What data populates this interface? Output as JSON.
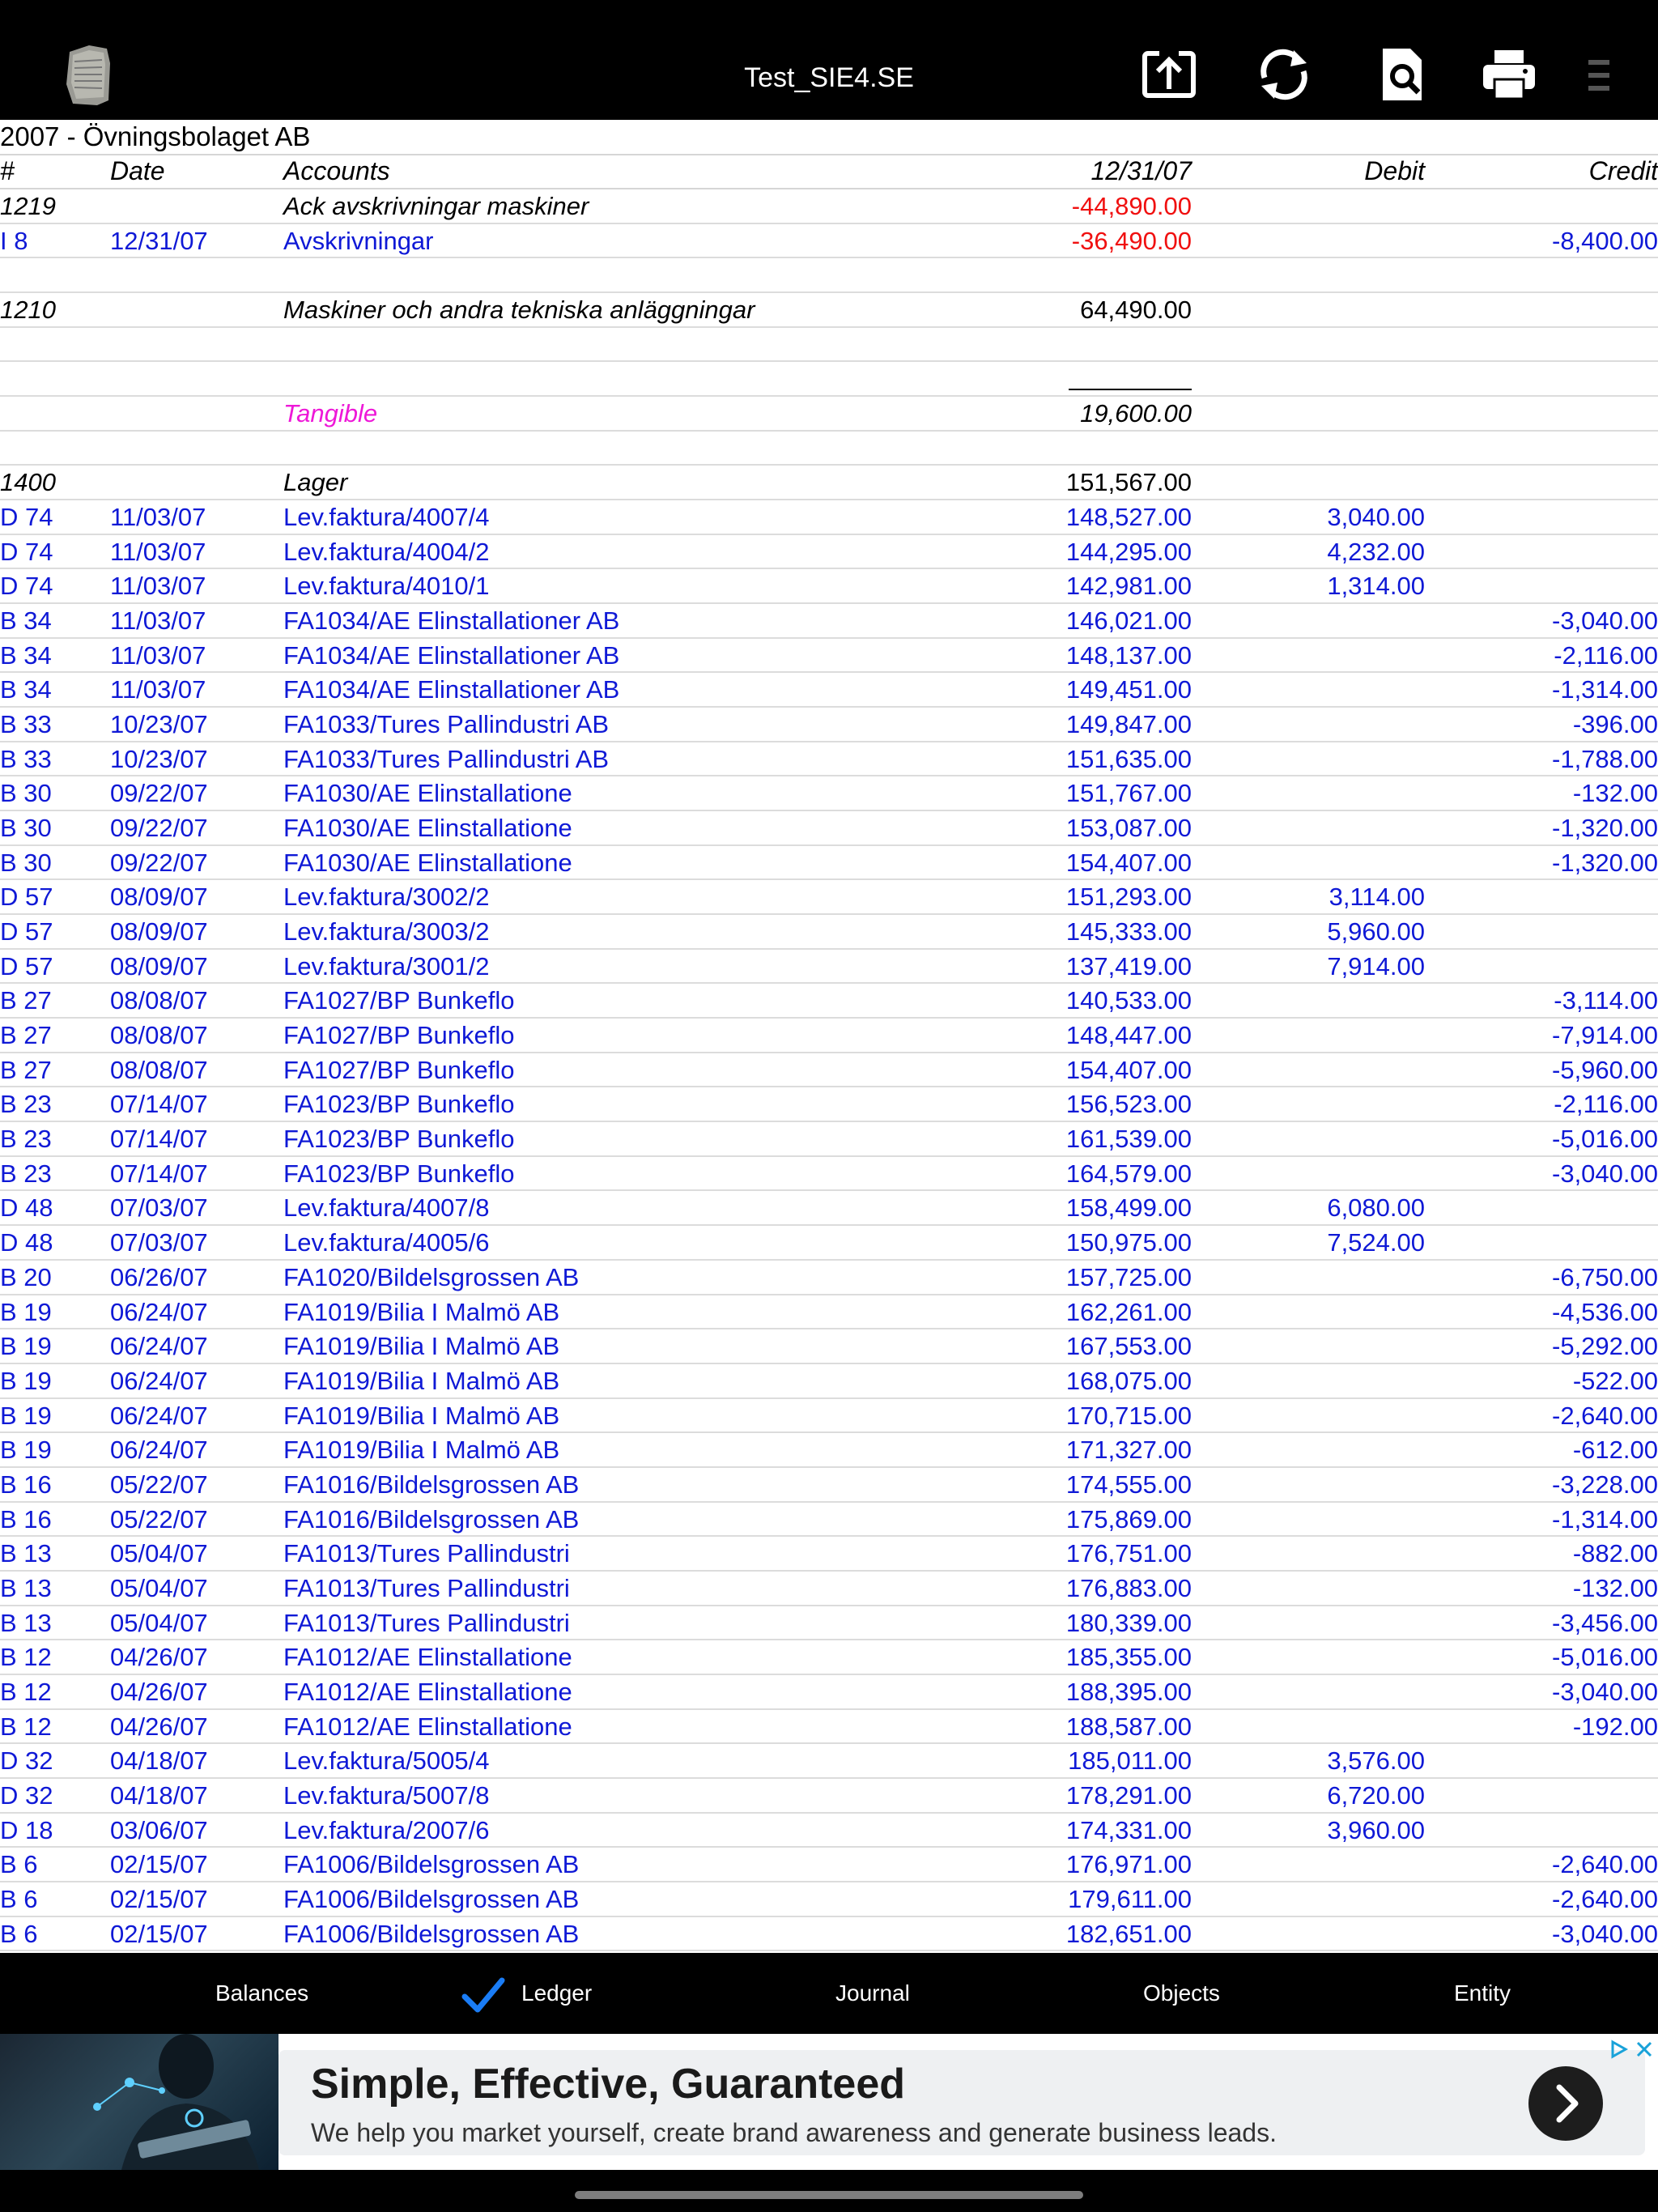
{
  "window": {
    "title": "Test_SIE4.SE",
    "icons": [
      "app-logo-icon",
      "export-icon",
      "sync-icon",
      "search-document-icon",
      "print-icon",
      "more-icon"
    ]
  },
  "ledger": {
    "company": "2007 - Övningsbolaget AB",
    "columns": {
      "num": "#",
      "date": "Date",
      "accounts": "Accounts",
      "balance": "12/31/07",
      "debit": "Debit",
      "credit": "Credit"
    },
    "rows": [
      {
        "type": "header",
        "num": "1219",
        "date": "",
        "account": "Ack avskrivningar maskiner",
        "balance": "-44,890.00",
        "debit": "",
        "credit": ""
      },
      {
        "type": "entry",
        "num": "I 8",
        "date": "12/31/07",
        "account": "Avskrivningar",
        "balance": "-36,490.00",
        "debit": "",
        "credit": "-8,400.00"
      },
      {
        "type": "blank"
      },
      {
        "type": "header",
        "num": "1210",
        "date": "",
        "account": "Maskiner och andra tekniska anläggningar",
        "balance": "64,490.00",
        "debit": "",
        "credit": ""
      },
      {
        "type": "blank"
      },
      {
        "type": "rule"
      },
      {
        "type": "subtotal",
        "account": "Tangible",
        "balance": "19,600.00"
      },
      {
        "type": "blank"
      },
      {
        "type": "header",
        "num": "1400",
        "date": "",
        "account": "Lager",
        "balance": "151,567.00",
        "debit": "",
        "credit": ""
      },
      {
        "type": "entry",
        "num": "D 74",
        "date": "11/03/07",
        "account": "Lev.faktura/4007/4",
        "balance": "148,527.00",
        "debit": "3,040.00",
        "credit": ""
      },
      {
        "type": "entry",
        "num": "D 74",
        "date": "11/03/07",
        "account": "Lev.faktura/4004/2",
        "balance": "144,295.00",
        "debit": "4,232.00",
        "credit": ""
      },
      {
        "type": "entry",
        "num": "D 74",
        "date": "11/03/07",
        "account": "Lev.faktura/4010/1",
        "balance": "142,981.00",
        "debit": "1,314.00",
        "credit": ""
      },
      {
        "type": "entry",
        "num": "B 34",
        "date": "11/03/07",
        "account": "FA1034/AE Elinstallationer AB",
        "balance": "146,021.00",
        "debit": "",
        "credit": "-3,040.00"
      },
      {
        "type": "entry",
        "num": "B 34",
        "date": "11/03/07",
        "account": "FA1034/AE Elinstallationer AB",
        "balance": "148,137.00",
        "debit": "",
        "credit": "-2,116.00"
      },
      {
        "type": "entry",
        "num": "B 34",
        "date": "11/03/07",
        "account": "FA1034/AE Elinstallationer AB",
        "balance": "149,451.00",
        "debit": "",
        "credit": "-1,314.00"
      },
      {
        "type": "entry",
        "num": "B 33",
        "date": "10/23/07",
        "account": "FA1033/Tures Pallindustri AB",
        "balance": "149,847.00",
        "debit": "",
        "credit": "-396.00"
      },
      {
        "type": "entry",
        "num": "B 33",
        "date": "10/23/07",
        "account": "FA1033/Tures Pallindustri AB",
        "balance": "151,635.00",
        "debit": "",
        "credit": "-1,788.00"
      },
      {
        "type": "entry",
        "num": "B 30",
        "date": "09/22/07",
        "account": "FA1030/AE Elinstallatione",
        "balance": "151,767.00",
        "debit": "",
        "credit": "-132.00"
      },
      {
        "type": "entry",
        "num": "B 30",
        "date": "09/22/07",
        "account": "FA1030/AE Elinstallatione",
        "balance": "153,087.00",
        "debit": "",
        "credit": "-1,320.00"
      },
      {
        "type": "entry",
        "num": "B 30",
        "date": "09/22/07",
        "account": "FA1030/AE Elinstallatione",
        "balance": "154,407.00",
        "debit": "",
        "credit": "-1,320.00"
      },
      {
        "type": "entry",
        "num": "D 57",
        "date": "08/09/07",
        "account": "Lev.faktura/3002/2",
        "balance": "151,293.00",
        "debit": "3,114.00",
        "credit": ""
      },
      {
        "type": "entry",
        "num": "D 57",
        "date": "08/09/07",
        "account": "Lev.faktura/3003/2",
        "balance": "145,333.00",
        "debit": "5,960.00",
        "credit": ""
      },
      {
        "type": "entry",
        "num": "D 57",
        "date": "08/09/07",
        "account": "Lev.faktura/3001/2",
        "balance": "137,419.00",
        "debit": "7,914.00",
        "credit": ""
      },
      {
        "type": "entry",
        "num": "B 27",
        "date": "08/08/07",
        "account": "FA1027/BP Bunkeflo",
        "balance": "140,533.00",
        "debit": "",
        "credit": "-3,114.00"
      },
      {
        "type": "entry",
        "num": "B 27",
        "date": "08/08/07",
        "account": "FA1027/BP Bunkeflo",
        "balance": "148,447.00",
        "debit": "",
        "credit": "-7,914.00"
      },
      {
        "type": "entry",
        "num": "B 27",
        "date": "08/08/07",
        "account": "FA1027/BP Bunkeflo",
        "balance": "154,407.00",
        "debit": "",
        "credit": "-5,960.00"
      },
      {
        "type": "entry",
        "num": "B 23",
        "date": "07/14/07",
        "account": "FA1023/BP Bunkeflo",
        "balance": "156,523.00",
        "debit": "",
        "credit": "-2,116.00"
      },
      {
        "type": "entry",
        "num": "B 23",
        "date": "07/14/07",
        "account": "FA1023/BP Bunkeflo",
        "balance": "161,539.00",
        "debit": "",
        "credit": "-5,016.00"
      },
      {
        "type": "entry",
        "num": "B 23",
        "date": "07/14/07",
        "account": "FA1023/BP Bunkeflo",
        "balance": "164,579.00",
        "debit": "",
        "credit": "-3,040.00"
      },
      {
        "type": "entry",
        "num": "D 48",
        "date": "07/03/07",
        "account": "Lev.faktura/4007/8",
        "balance": "158,499.00",
        "debit": "6,080.00",
        "credit": ""
      },
      {
        "type": "entry",
        "num": "D 48",
        "date": "07/03/07",
        "account": "Lev.faktura/4005/6",
        "balance": "150,975.00",
        "debit": "7,524.00",
        "credit": ""
      },
      {
        "type": "entry",
        "num": "B 20",
        "date": "06/26/07",
        "account": "FA1020/Bildelsgrossen AB",
        "balance": "157,725.00",
        "debit": "",
        "credit": "-6,750.00"
      },
      {
        "type": "entry",
        "num": "B 19",
        "date": "06/24/07",
        "account": "FA1019/Bilia I Malmö AB",
        "balance": "162,261.00",
        "debit": "",
        "credit": "-4,536.00"
      },
      {
        "type": "entry",
        "num": "B 19",
        "date": "06/24/07",
        "account": "FA1019/Bilia I Malmö AB",
        "balance": "167,553.00",
        "debit": "",
        "credit": "-5,292.00"
      },
      {
        "type": "entry",
        "num": "B 19",
        "date": "06/24/07",
        "account": "FA1019/Bilia I Malmö AB",
        "balance": "168,075.00",
        "debit": "",
        "credit": "-522.00"
      },
      {
        "type": "entry",
        "num": "B 19",
        "date": "06/24/07",
        "account": "FA1019/Bilia I Malmö AB",
        "balance": "170,715.00",
        "debit": "",
        "credit": "-2,640.00"
      },
      {
        "type": "entry",
        "num": "B 19",
        "date": "06/24/07",
        "account": "FA1019/Bilia I Malmö AB",
        "balance": "171,327.00",
        "debit": "",
        "credit": "-612.00"
      },
      {
        "type": "entry",
        "num": "B 16",
        "date": "05/22/07",
        "account": "FA1016/Bildelsgrossen AB",
        "balance": "174,555.00",
        "debit": "",
        "credit": "-3,228.00"
      },
      {
        "type": "entry",
        "num": "B 16",
        "date": "05/22/07",
        "account": "FA1016/Bildelsgrossen AB",
        "balance": "175,869.00",
        "debit": "",
        "credit": "-1,314.00"
      },
      {
        "type": "entry",
        "num": "B 13",
        "date": "05/04/07",
        "account": "FA1013/Tures Pallindustri",
        "balance": "176,751.00",
        "debit": "",
        "credit": "-882.00"
      },
      {
        "type": "entry",
        "num": "B 13",
        "date": "05/04/07",
        "account": "FA1013/Tures Pallindustri",
        "balance": "176,883.00",
        "debit": "",
        "credit": "-132.00"
      },
      {
        "type": "entry",
        "num": "B 13",
        "date": "05/04/07",
        "account": "FA1013/Tures Pallindustri",
        "balance": "180,339.00",
        "debit": "",
        "credit": "-3,456.00"
      },
      {
        "type": "entry",
        "num": "B 12",
        "date": "04/26/07",
        "account": "FA1012/AE Elinstallatione",
        "balance": "185,355.00",
        "debit": "",
        "credit": "-5,016.00"
      },
      {
        "type": "entry",
        "num": "B 12",
        "date": "04/26/07",
        "account": "FA1012/AE Elinstallatione",
        "balance": "188,395.00",
        "debit": "",
        "credit": "-3,040.00"
      },
      {
        "type": "entry",
        "num": "B 12",
        "date": "04/26/07",
        "account": "FA1012/AE Elinstallatione",
        "balance": "188,587.00",
        "debit": "",
        "credit": "-192.00"
      },
      {
        "type": "entry",
        "num": "D 32",
        "date": "04/18/07",
        "account": "Lev.faktura/5005/4",
        "balance": "185,011.00",
        "debit": "3,576.00",
        "credit": ""
      },
      {
        "type": "entry",
        "num": "D 32",
        "date": "04/18/07",
        "account": "Lev.faktura/5007/8",
        "balance": "178,291.00",
        "debit": "6,720.00",
        "credit": ""
      },
      {
        "type": "entry",
        "num": "D 18",
        "date": "03/06/07",
        "account": "Lev.faktura/2007/6",
        "balance": "174,331.00",
        "debit": "3,960.00",
        "credit": ""
      },
      {
        "type": "entry",
        "num": "B 6",
        "date": "02/15/07",
        "account": "FA1006/Bildelsgrossen AB",
        "balance": "176,971.00",
        "debit": "",
        "credit": "-2,640.00"
      },
      {
        "type": "entry",
        "num": "B 6",
        "date": "02/15/07",
        "account": "FA1006/Bildelsgrossen AB",
        "balance": "179,611.00",
        "debit": "",
        "credit": "-2,640.00"
      },
      {
        "type": "entry",
        "num": "B 6",
        "date": "02/15/07",
        "account": "FA1006/Bildelsgrossen AB",
        "balance": "182,651.00",
        "debit": "",
        "credit": "-3,040.00"
      }
    ]
  },
  "tabs": [
    {
      "label": "Balances",
      "selected": false
    },
    {
      "label": "Ledger",
      "selected": true
    },
    {
      "label": "Journal",
      "selected": false
    },
    {
      "label": "Objects",
      "selected": false
    },
    {
      "label": "Entity",
      "selected": false
    }
  ],
  "ad": {
    "title": "Simple, Effective, Guaranteed",
    "body": "We help you market yourself, create brand awareness and generate business leads.",
    "icons": [
      "chevron-right-icon",
      "ad-info-icon",
      "close-icon"
    ]
  },
  "colors": {
    "entry_text": "#0f19d6",
    "negative": "#f01010",
    "subtotal_label": "#ee18d8",
    "bars": "#000000"
  }
}
